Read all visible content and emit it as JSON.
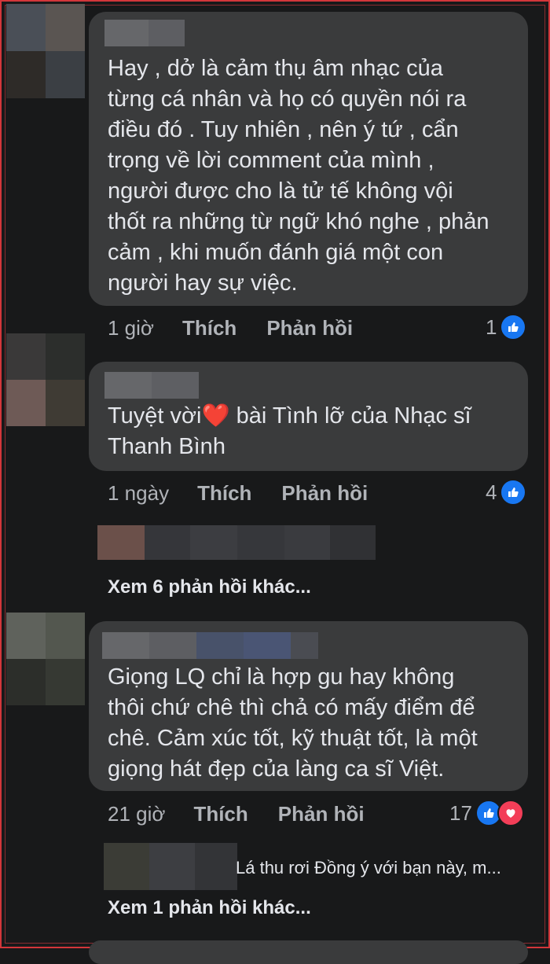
{
  "colors": {
    "background": "#18191a",
    "bubble": "#3a3b3c",
    "text": "#e4e6eb",
    "secondary": "#b0b3b8",
    "like": "#1877f2",
    "love": "#f33e58",
    "frame": "#d3363a"
  },
  "comments": [
    {
      "text": "Hay , dở là cảm thụ âm nhạc của\ntừng cá nhân và họ có quyền nói ra\nđiều đó . Tuy nhiên , nên ý tứ , cẩn\ntrọng về lời comment của mình ,\nngười được cho là tử tế không vội\nthốt ra những từ ngữ khó nghe , phản\ncảm , khi muốn đánh giá một con\nngười hay sự việc.",
      "time": "1 giờ",
      "like_label": "Thích",
      "reply_label": "Phản hồi",
      "reaction_count": "1",
      "reaction_icons": [
        "like-icon"
      ]
    },
    {
      "text_before": "Tuyệt vời",
      "emoji": "❤️",
      "text_after": " bài Tình lỡ của Nhạc sĩ\nThanh Bình",
      "time": "1 ngày",
      "like_label": "Thích",
      "reply_label": "Phản hồi",
      "reaction_count": "4",
      "reaction_icons": [
        "like-icon"
      ],
      "more_replies": "Xem 6 phản hồi khác..."
    },
    {
      "text": "Giọng LQ chỉ là hợp gu hay không\nthôi chứ chê thì chả có mấy điểm để\nchê. Cảm xúc tốt, kỹ thuật tốt, là một\ngiọng hát đẹp của làng ca sĩ Việt.",
      "time": "21 giờ",
      "like_label": "Thích",
      "reply_label": "Phản hồi",
      "reaction_count": "17",
      "reaction_icons": [
        "like-icon",
        "heart-icon"
      ],
      "reply_preview": "Lá thu rơi Đồng ý với bạn này, m...",
      "more_replies": "Xem 1 phản hồi khác..."
    }
  ]
}
